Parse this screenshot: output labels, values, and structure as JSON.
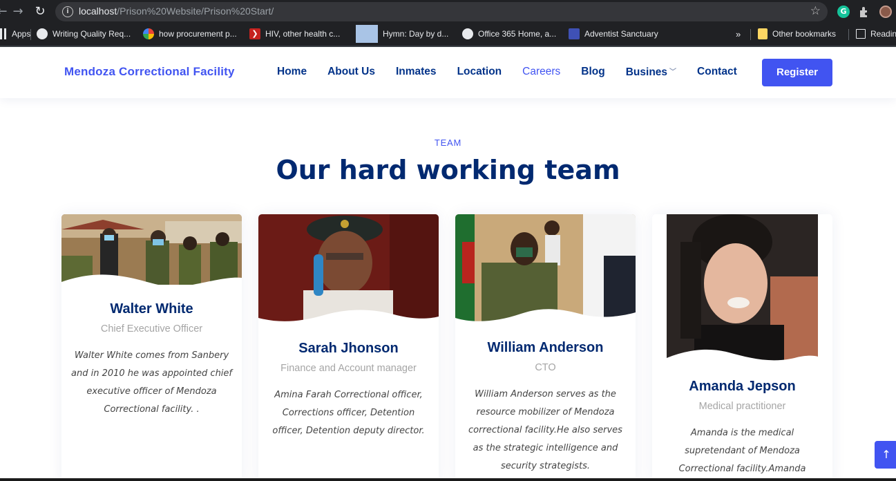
{
  "browser": {
    "url_host": "localhost",
    "url_path": "/Prison%20Website/Prison%20Start/",
    "bookmarks": [
      {
        "label": "Apps",
        "icon": "apps-grid-icon"
      },
      {
        "label": "Writing Quality Req...",
        "icon": "globe-icon"
      },
      {
        "label": "how procurement p...",
        "icon": "google-icon"
      },
      {
        "label": "HIV, other health c...",
        "icon": "red-chevron-icon"
      },
      {
        "label": "Hymn: Day by d...",
        "icon": "hymn-thumbnail-icon"
      },
      {
        "label": "Office 365 Home, a...",
        "icon": "globe-icon"
      },
      {
        "label": "Adventist Sanctuary",
        "icon": "sanctuary-icon"
      },
      {
        "label": "Other bookmarks",
        "icon": "folder-icon"
      },
      {
        "label": "Readin",
        "icon": "reading-list-icon"
      }
    ],
    "overflow": "»"
  },
  "site": {
    "logo": "Mendoza Correctional Facility",
    "menu": [
      "Home",
      "About Us",
      "Inmates",
      "Location",
      "Careers",
      "Blog",
      "Busines",
      "Contact"
    ],
    "active_menu": "Careers",
    "register": "Register"
  },
  "team": {
    "label": "TEAM",
    "title": "Our hard working team",
    "members": [
      {
        "name": "Walter White",
        "role": "Chief Executive Officer",
        "bio": "Walter White comes from Sanbery and in 2010 he was appointed chief executive officer of Mendoza Correctional facility. ."
      },
      {
        "name": "Sarah Jhonson",
        "role": "Finance and Account manager",
        "bio": "Amina Farah Correctional officer, Corrections officer, Detention officer, Detention deputy director."
      },
      {
        "name": "William Anderson",
        "role": "CTO",
        "bio": "William Anderson serves as the resource mobilizer of Mendoza correctional facility.He also serves as the strategic intelligence and security strategists."
      },
      {
        "name": "Amanda Jepson",
        "role": "Medical practitioner",
        "bio": "Amanda is the medical supretendant of Mendoza Correctional facility.Amanda doubles up as the"
      }
    ]
  },
  "colors": {
    "accent": "#4154f1",
    "heading": "#012970",
    "chrome_bg": "#202124"
  }
}
